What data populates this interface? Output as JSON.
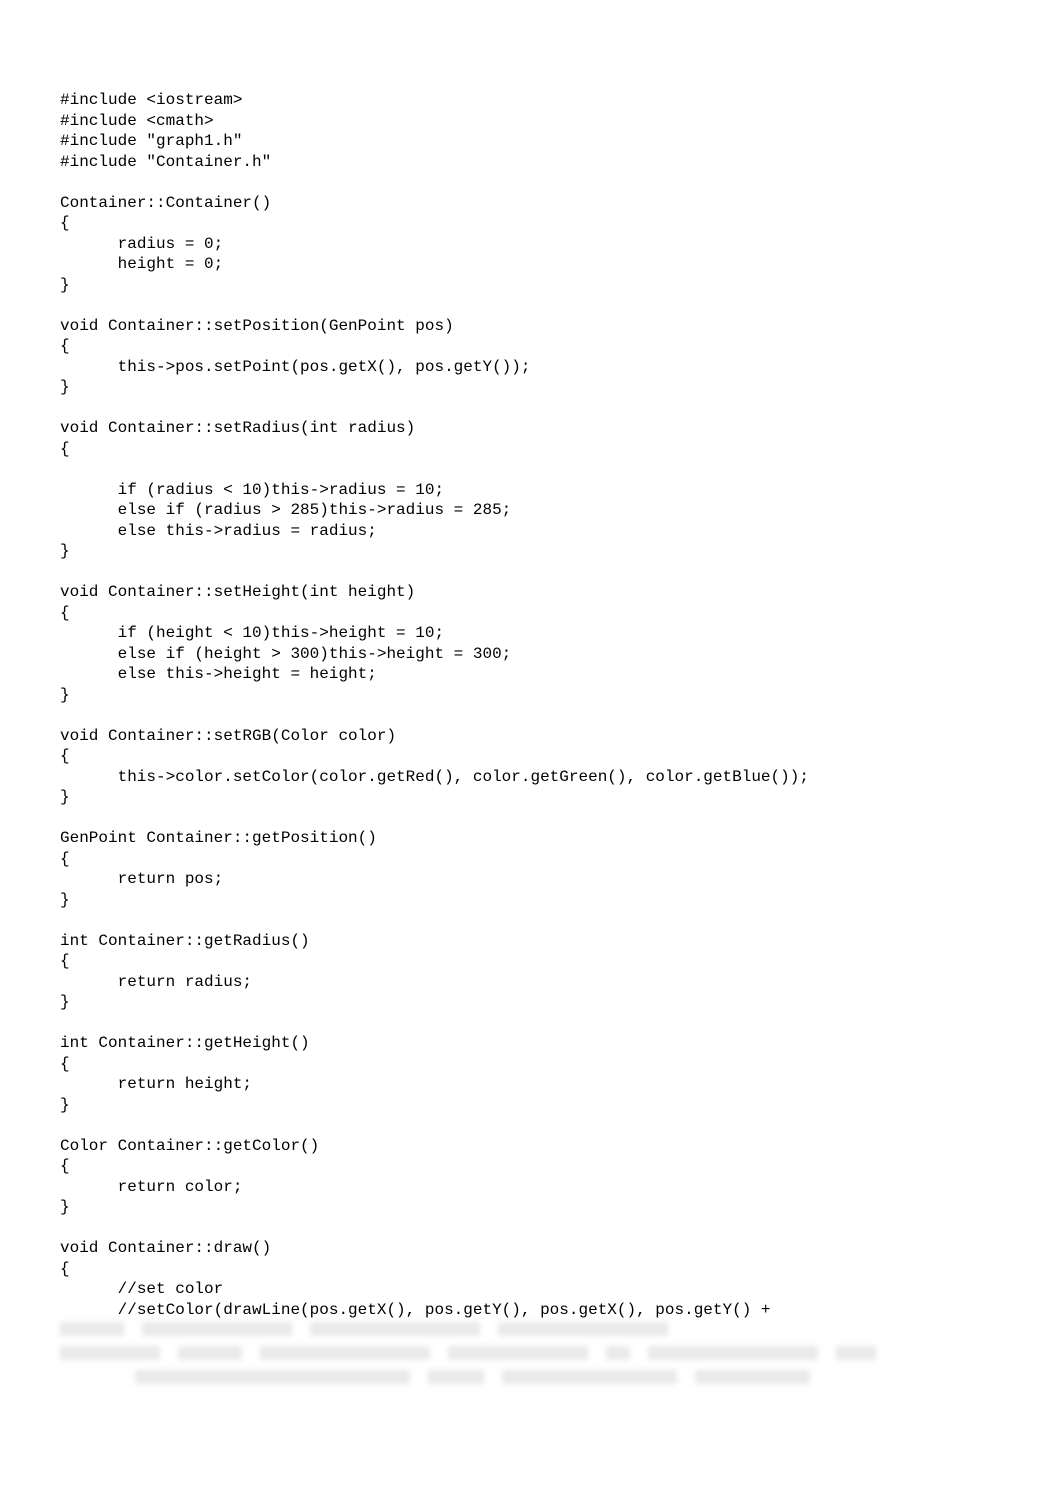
{
  "code": "#include <iostream>\n#include <cmath>\n#include \"graph1.h\"\n#include \"Container.h\"\n\nContainer::Container()\n{\n      radius = 0;\n      height = 0;\n}\n\nvoid Container::setPosition(GenPoint pos)\n{\n      this->pos.setPoint(pos.getX(), pos.getY());\n}\n\nvoid Container::setRadius(int radius)\n{\n\n      if (radius < 10)this->radius = 10;\n      else if (radius > 285)this->radius = 285;\n      else this->radius = radius;\n}\n\nvoid Container::setHeight(int height)\n{\n      if (height < 10)this->height = 10;\n      else if (height > 300)this->height = 300;\n      else this->height = height;\n}\n\nvoid Container::setRGB(Color color)\n{\n      this->color.setColor(color.getRed(), color.getGreen(), color.getBlue());\n}\n\nGenPoint Container::getPosition()\n{\n      return pos;\n}\n\nint Container::getRadius()\n{\n      return radius;\n}\n\nint Container::getHeight()\n{\n      return height;\n}\n\nColor Container::getColor()\n{\n      return color;\n}\n\nvoid Container::draw()\n{\n      //set color\n      //setColor(drawLine(pos.getX(), pos.getY(), pos.getX(), pos.getY() +"
}
